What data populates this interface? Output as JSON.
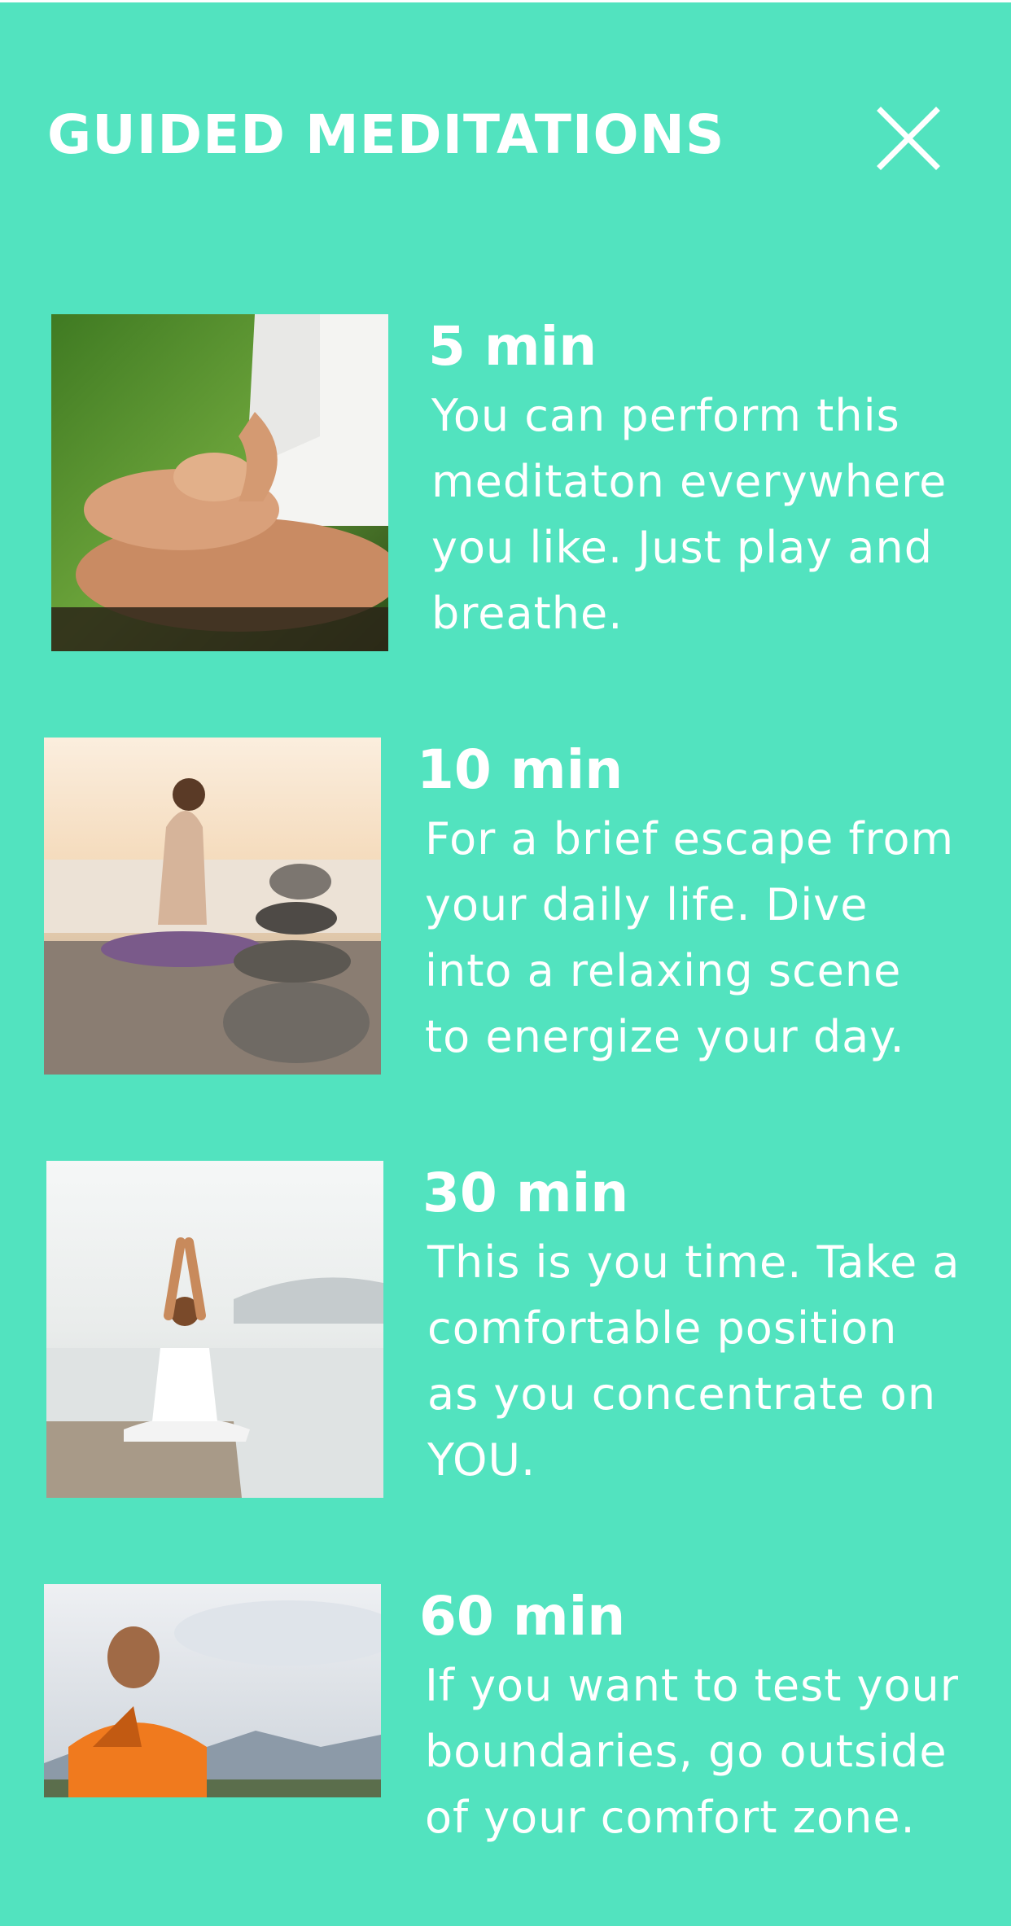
{
  "colors": {
    "background": "#52E3BF",
    "text": "#FFFFFF"
  },
  "header": {
    "title": "GUIDED MEDITATIONS",
    "close_icon": "close-icon"
  },
  "meditations": [
    {
      "duration": "5 min",
      "description_lines": [
        "You can perform this",
        "meditaton everywhere",
        "you like. Just play and",
        "breathe."
      ],
      "image": "lotus-hands-meditation-photo"
    },
    {
      "duration": "10 min",
      "description_lines": [
        "For a brief escape from",
        "your daily life. Dive",
        "into a relaxing scene",
        "to energize your day."
      ],
      "image": "stacked-stones-sunset-photo"
    },
    {
      "duration": "30 min",
      "description_lines": [
        "This is you time. Take a",
        "comfortable position",
        "as you concentrate on",
        "YOU."
      ],
      "image": "pier-sea-yoga-photo"
    },
    {
      "duration": "60 min",
      "description_lines": [
        "If you want to test your",
        "boundaries, go outside",
        "of your comfort zone."
      ],
      "image": "monk-mountains-photo"
    }
  ]
}
